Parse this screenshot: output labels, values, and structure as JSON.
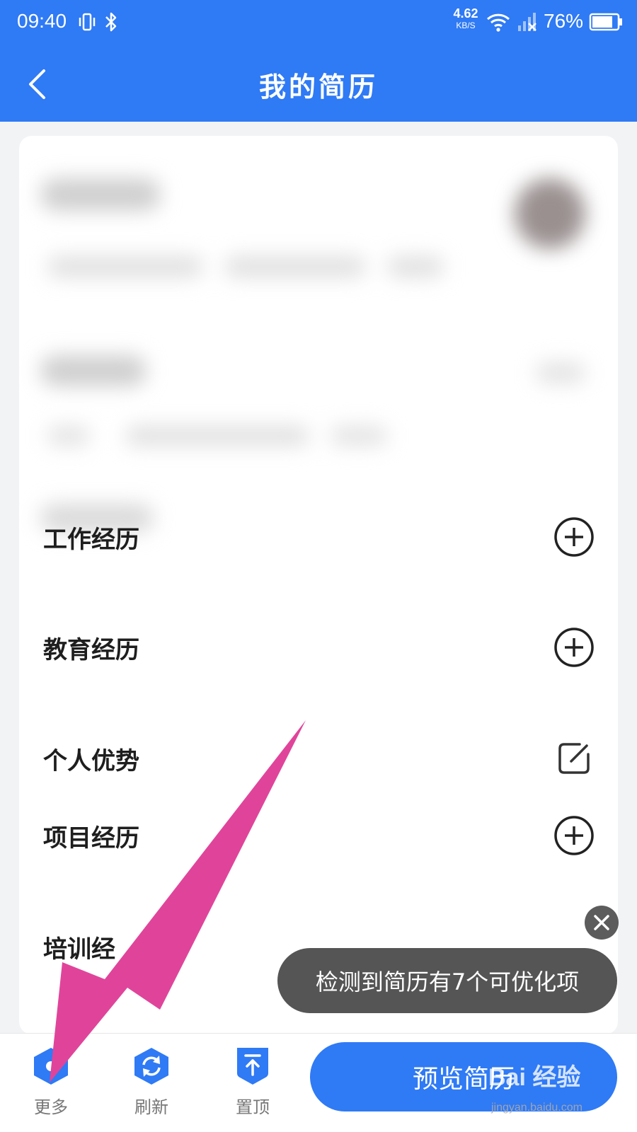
{
  "status_bar": {
    "time": "09:40",
    "net_speed_value": "4.62",
    "net_speed_unit": "KB/S",
    "battery": "76%"
  },
  "nav": {
    "title": "我的简历"
  },
  "sections": [
    {
      "label": "工作经历",
      "action": "add"
    },
    {
      "label": "教育经历",
      "action": "add"
    },
    {
      "label": "个人优势",
      "action": "edit"
    },
    {
      "label": "项目经历",
      "action": "add"
    },
    {
      "label": "培训经",
      "action": "add"
    }
  ],
  "toast": {
    "text": "检测到简历有7个可优化项"
  },
  "bottom_bar": {
    "more_label": "更多",
    "refresh_label": "刷新",
    "top_label": "置顶",
    "preview_label": "预览简历"
  },
  "watermark": {
    "brand": "Bai  经验",
    "url": "jingyan.baidu.com"
  },
  "colors": {
    "primary": "#2f7af5",
    "annotation_arrow": "#e0449a"
  },
  "icons": {
    "back": "chevron-left-icon",
    "add": "plus-circle-icon",
    "edit": "edit-icon",
    "close": "close-icon",
    "more": "hexagon-dot-icon",
    "refresh": "refresh-icon",
    "top": "arrow-up-icon"
  }
}
